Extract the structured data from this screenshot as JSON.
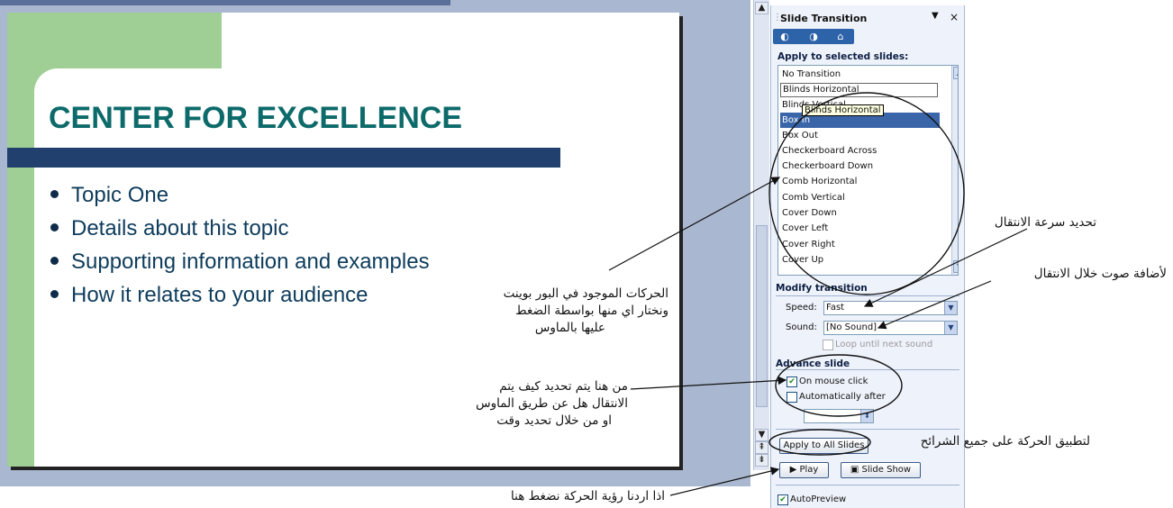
{
  "slide": {
    "title": "CENTER FOR EXCELLENCE",
    "bullets": [
      "Topic One",
      "Details about this topic",
      "Supporting information and examples",
      "How it relates to your audience"
    ]
  },
  "pane": {
    "title": "Slide Transition",
    "apply_heading": "Apply to selected slides:",
    "transitions": [
      "No Transition",
      "Blinds Horizontal",
      "Blinds Vertical",
      "Box In",
      "Box Out",
      "Checkerboard Across",
      "Checkerboard Down",
      "Comb Horizontal",
      "Comb Vertical",
      "Cover Down",
      "Cover Left",
      "Cover Right",
      "Cover Up"
    ],
    "selected_transition": "Box In",
    "tooltip": "Blinds Horizontal",
    "modify_heading": "Modify transition",
    "speed_label": "Speed:",
    "speed_value": "Fast",
    "sound_label": "Sound:",
    "sound_value": "[No Sound]",
    "loop_label": "Loop until next sound",
    "advance_heading": "Advance slide",
    "on_mouse_click_label": "On mouse click",
    "on_mouse_click_checked": true,
    "auto_after_label": "Automatically after",
    "auto_after_checked": false,
    "apply_all_label": "Apply to All Slides",
    "play_label": "Play",
    "slideshow_label": "Slide Show",
    "autopreview_label": "AutoPreview",
    "autopreview_checked": true
  },
  "annotations": {
    "animations": [
      "الحركات الموجود في البور بوينت",
      "ونختار اي منها بواسطة الضغط",
      "عليها بالماوس"
    ],
    "speed": "تحديد سرعة الانتقال",
    "sound": "لأضافة صوت خلال الانتقال",
    "advance": [
      "من هنا يتم تحديد كيف يتم",
      "الانتقال هل عن طريق الماوس",
      "او من خلال تحديد وقت"
    ],
    "apply_all": "لتطبيق الحركة على جميع الشرائح",
    "play": "اذا اردنا رؤية الحركة نضغط هنا"
  },
  "colors": {
    "title_teal": "#0d6a6a",
    "bar_navy": "#22406e",
    "slide_green": "#9fcf95",
    "selection_blue": "#3a65a8"
  }
}
